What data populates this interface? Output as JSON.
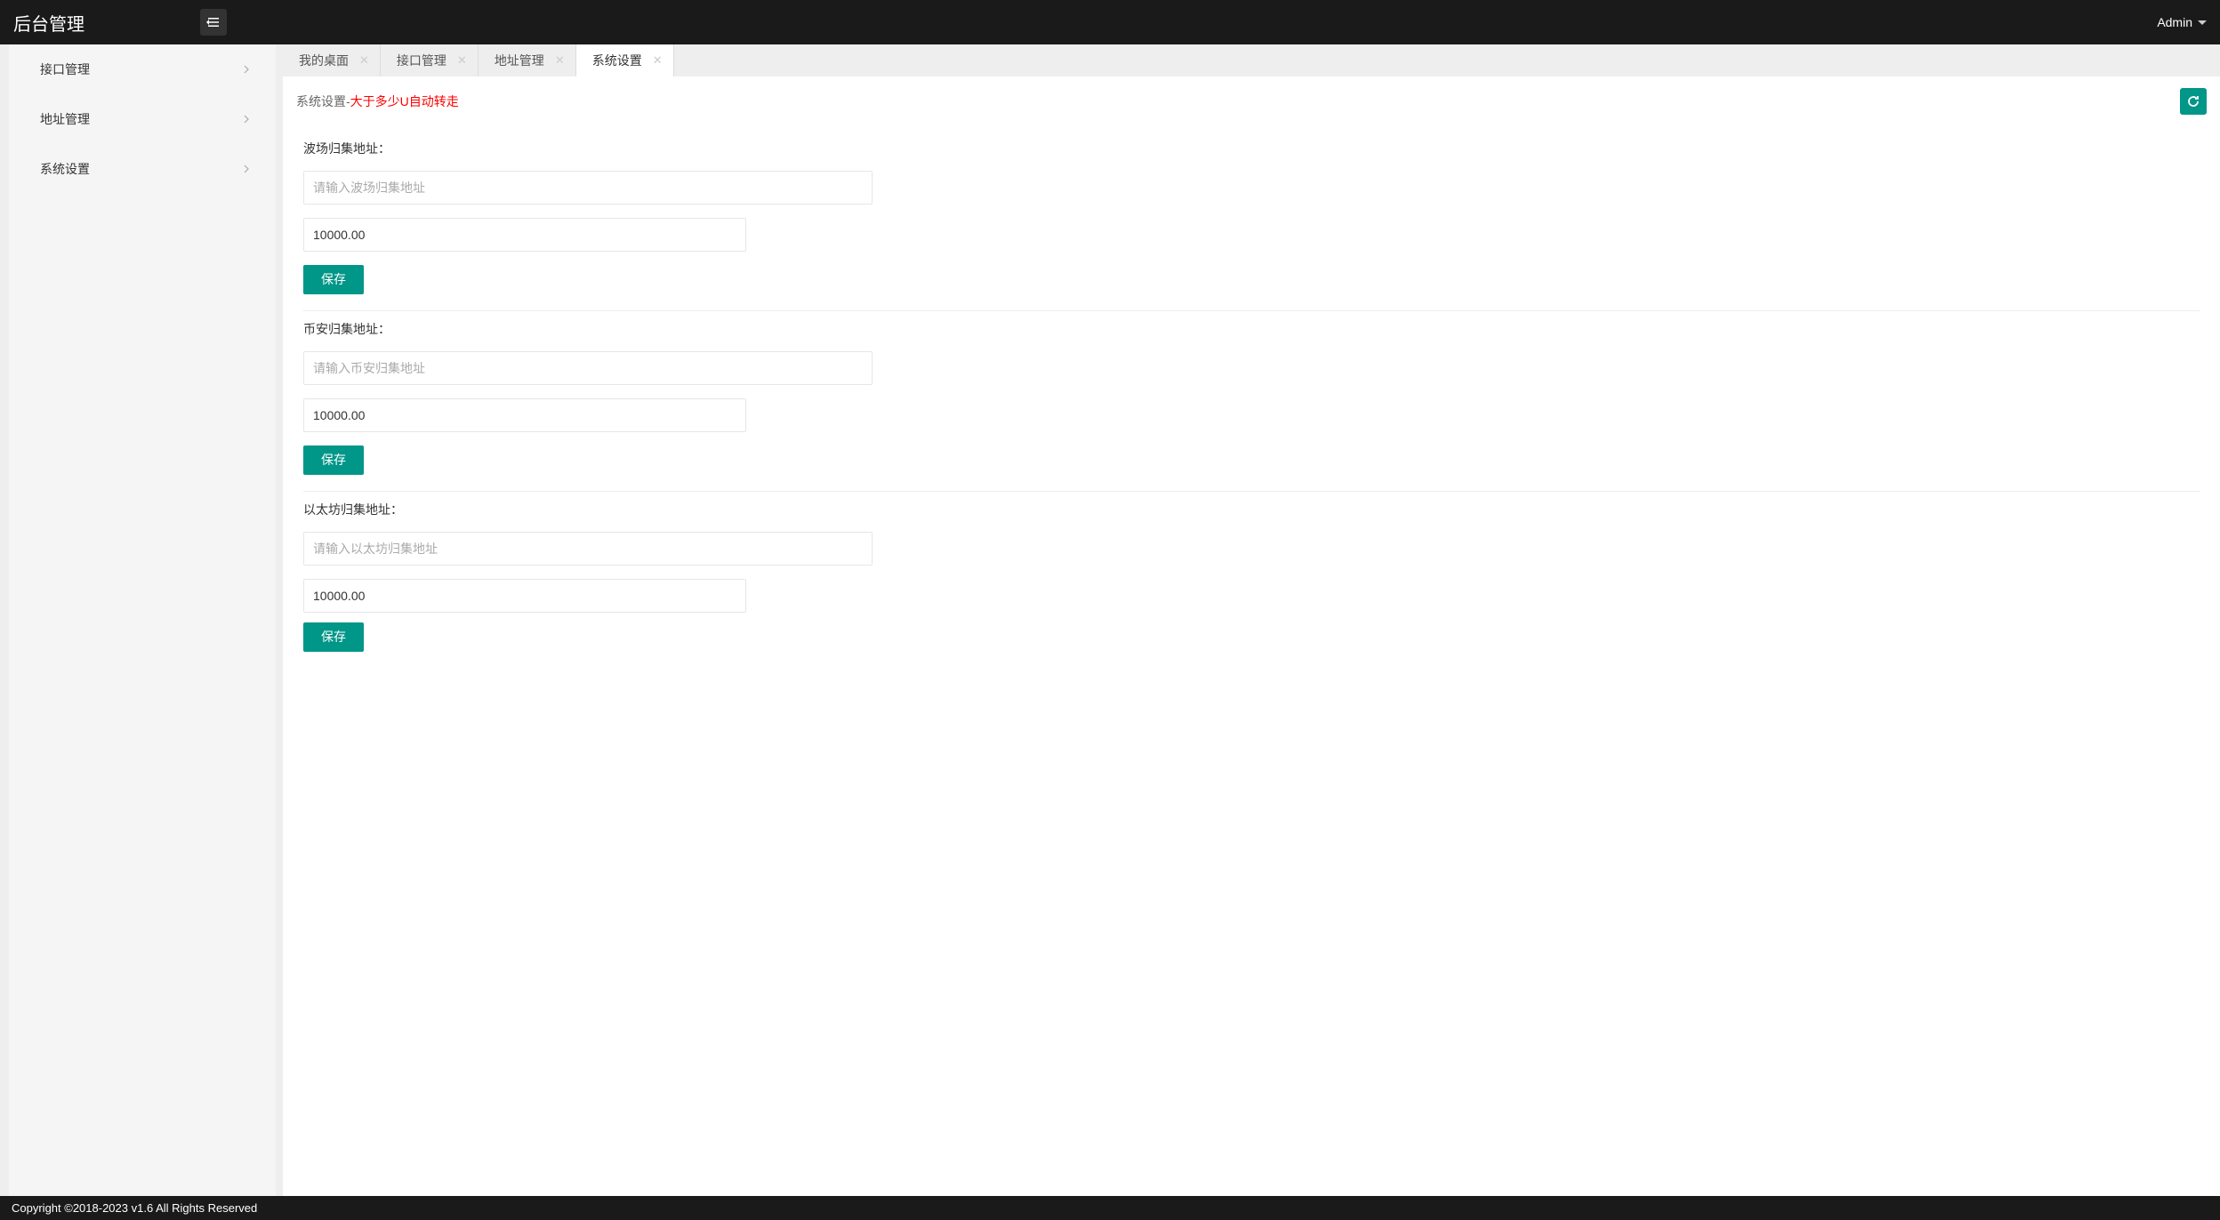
{
  "header": {
    "logo": "后台管理",
    "user": "Admin"
  },
  "sidebar": {
    "items": [
      {
        "label": "接口管理"
      },
      {
        "label": "地址管理"
      },
      {
        "label": "系统设置"
      }
    ]
  },
  "tabs": [
    {
      "label": "我的桌面",
      "closable": true,
      "active": false
    },
    {
      "label": "接口管理",
      "closable": true,
      "active": false
    },
    {
      "label": "地址管理",
      "closable": true,
      "active": false
    },
    {
      "label": "系统设置",
      "closable": true,
      "active": true
    }
  ],
  "page": {
    "title_prefix": "系统设置-",
    "title_red": "大于多少U自动转走"
  },
  "forms": {
    "tron": {
      "label": "波场归集地址：",
      "address_placeholder": "请输入波场归集地址",
      "address_value": "",
      "amount_value": "10000.00",
      "save": "保存"
    },
    "binance": {
      "label": "币安归集地址：",
      "address_placeholder": "请输入币安归集地址",
      "address_value": "",
      "amount_value": "10000.00",
      "save": "保存"
    },
    "eth": {
      "label": "以太坊归集地址：",
      "address_placeholder": "请输入以太坊归集地址",
      "address_value": "",
      "amount_value": "10000.00",
      "save": "保存"
    }
  },
  "footer": {
    "text": "Copyright ©2018-2023 v1.6 All Rights Reserved"
  }
}
